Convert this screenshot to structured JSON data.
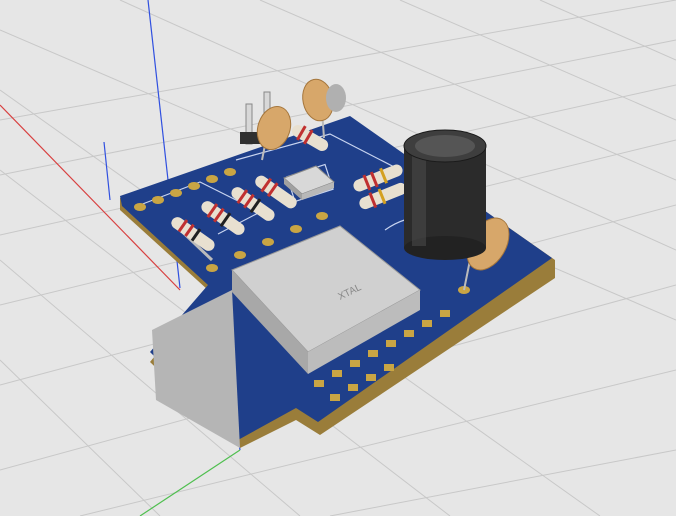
{
  "colors": {
    "background": "#e6e6e6",
    "grid": "#c8c8c8",
    "board": "#1f3f8a",
    "board_edge": "#9a7d3a",
    "pad": "#c9a544",
    "crystal": "#c4c4c4",
    "capacitor": "#d7a76a",
    "electrolytic": "#2b2b2b",
    "axis_x": "#d84040",
    "axis_y": "#4fbf4f",
    "axis_z": "#3050e0"
  },
  "icons": {
    "axis_x": "x-axis-line",
    "axis_y": "y-axis-line",
    "axis_z": "z-axis-line"
  },
  "labels": {
    "crystal_marking": "XTAL"
  }
}
